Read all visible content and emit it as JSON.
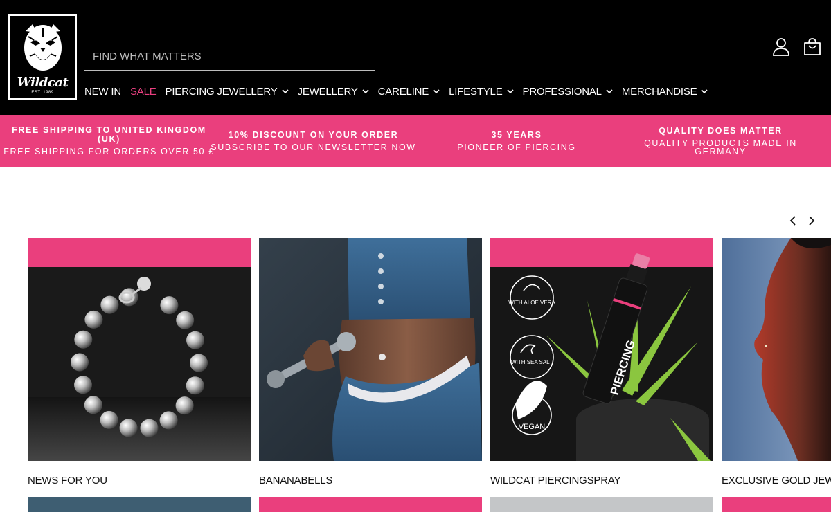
{
  "brand": {
    "name": "Wildcat",
    "est": "EST. 1989"
  },
  "search": {
    "placeholder": "FIND WHAT MATTERS",
    "value": ""
  },
  "nav": [
    {
      "label": "NEW IN",
      "dropdown": false
    },
    {
      "label": "SALE",
      "dropdown": false,
      "highlight": "#ea4080"
    },
    {
      "label": "PIERCING JEWELLERY",
      "dropdown": true
    },
    {
      "label": "JEWELLERY",
      "dropdown": true
    },
    {
      "label": "CARELINE",
      "dropdown": true
    },
    {
      "label": "LIFESTYLE",
      "dropdown": true
    },
    {
      "label": "PROFESSIONAL",
      "dropdown": true
    },
    {
      "label": "MERCHANDISE",
      "dropdown": true
    }
  ],
  "header_icons": {
    "account": "user-icon",
    "cart": "shopping-bag-icon"
  },
  "usp": [
    {
      "title": "FREE SHIPPING TO UNITED KINGDOM (UK)",
      "subtitle": "FREE SHIPPING FOR ORDERS OVER 50 £"
    },
    {
      "title": "10% DISCOUNT ON YOUR ORDER",
      "subtitle": "SUBSCRIBE TO OUR NEWSLETTER NOW"
    },
    {
      "title": "35 YEARS",
      "subtitle": "PIONEER OF PIERCING"
    },
    {
      "title": "QUALITY DOES MATTER",
      "subtitle": "QUALITY PRODUCTS MADE IN GERMANY"
    }
  ],
  "carousel": {
    "prev_icon": "chevron-left-icon",
    "next_icon": "chevron-right-icon",
    "tiles": [
      {
        "caption": "NEWS FOR YOU"
      },
      {
        "caption": "BANANABELLS"
      },
      {
        "caption": "WILDCAT PIERCINGSPRAY",
        "badges": [
          "WITH ALOE VERA",
          "WITH SEA SALT",
          "VEGAN"
        ],
        "product_label": "PIERCING"
      },
      {
        "caption": "EXCLUSIVE GOLD JEW"
      }
    ]
  },
  "colors": {
    "accent": "#ea3f7d",
    "header_bg": "#000000"
  }
}
